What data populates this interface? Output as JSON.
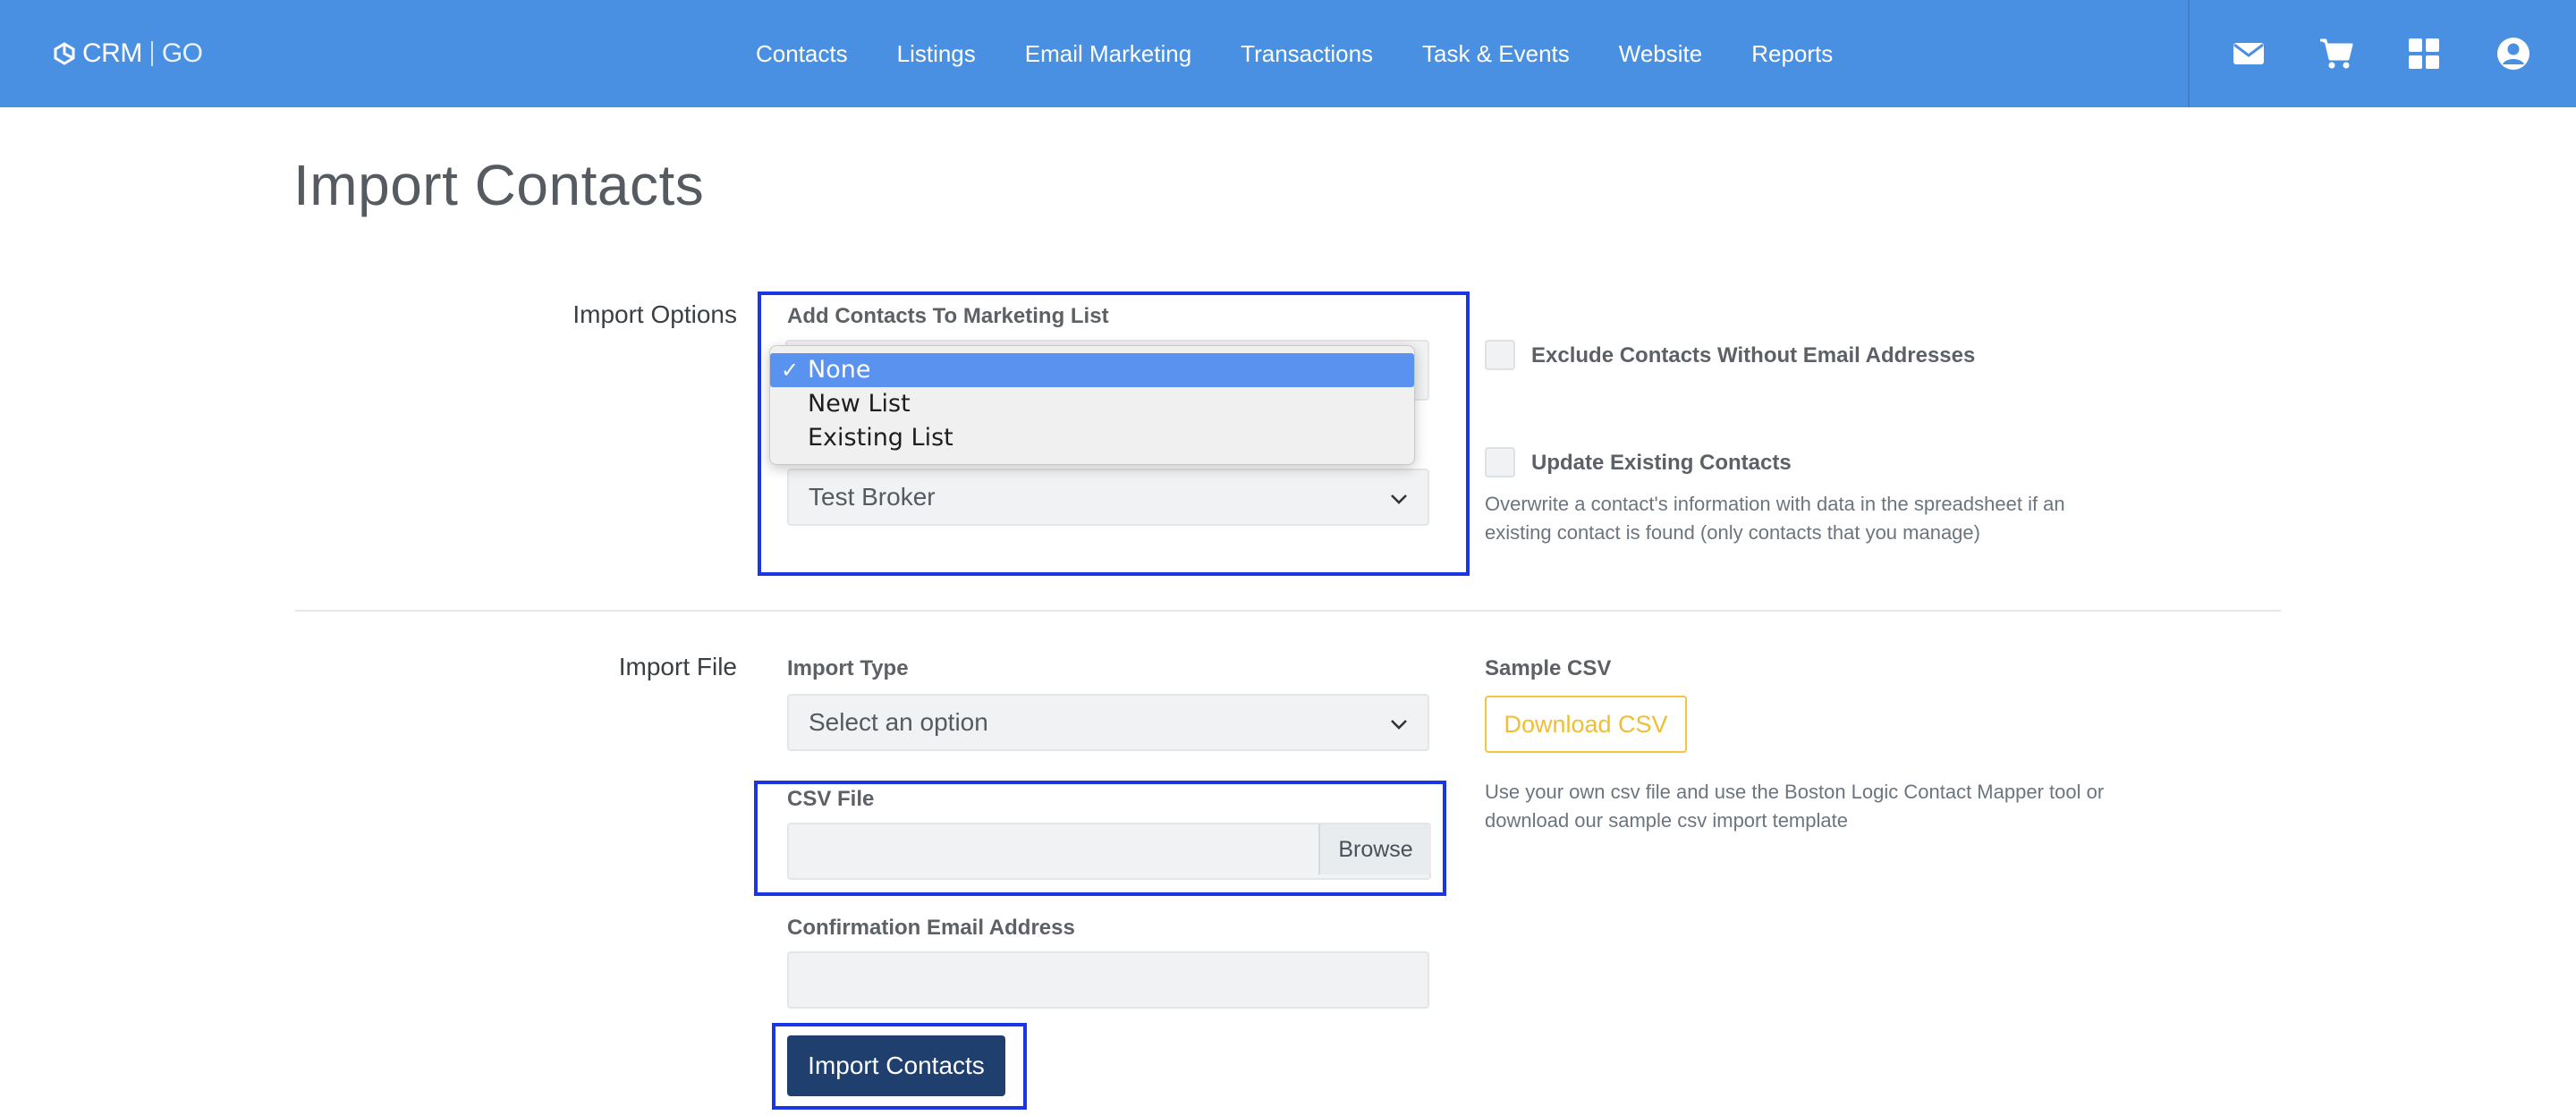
{
  "brand": {
    "part1": "CRM",
    "part2": "GO"
  },
  "nav": {
    "links": [
      "Contacts",
      "Listings",
      "Email Marketing",
      "Transactions",
      "Task & Events",
      "Website",
      "Reports"
    ],
    "icons": [
      "mail-icon",
      "cart-icon",
      "apps-grid-icon",
      "user-account-icon"
    ]
  },
  "page": {
    "title": "Import Contacts"
  },
  "import_options": {
    "label": "Import Options",
    "marketing_list": {
      "label": "Add Contacts To Marketing List",
      "options": [
        "None",
        "New List",
        "Existing List"
      ],
      "selected": "None"
    },
    "owner_select": {
      "value": "Test Broker"
    },
    "exclude_no_email": {
      "label": "Exclude Contacts Without Email Addresses",
      "checked": false
    },
    "update_existing": {
      "label": "Update Existing Contacts",
      "checked": false,
      "help_line1": "Overwrite a contact's information with data in the spreadsheet if an",
      "help_line2": "existing contact is found (only contacts that you manage)"
    }
  },
  "import_file": {
    "label": "Import File",
    "import_type": {
      "label": "Import Type",
      "value": "Select an option"
    },
    "csv_file": {
      "label": "CSV File",
      "browse_label": "Browse",
      "value": ""
    },
    "confirmation_email": {
      "label": "Confirmation Email Address",
      "value": ""
    },
    "sample_csv": {
      "label": "Sample CSV",
      "button_label": "Download CSV",
      "help_line1": "Use your own csv file and use the Boston Logic Contact Mapper tool or",
      "help_line2": "download our sample csv import template"
    },
    "submit_label": "Import Contacts"
  },
  "colors": {
    "navbar": "#4a90e2",
    "primary_button": "#1f3f6e",
    "download_button_accent": "#f5c542",
    "annotation_box": "#1a35e4",
    "dropdown_selected": "#5a92ef"
  }
}
